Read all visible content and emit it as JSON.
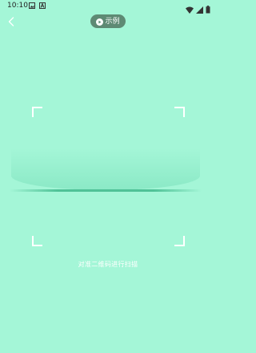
{
  "status_bar": {
    "time": "10:10",
    "icons": [
      "image-icon",
      "a-notification-icon",
      "wifi-icon",
      "signal-icon",
      "battery-icon"
    ]
  },
  "toolbar": {
    "back_icon": "chevron-left-icon",
    "example_label": "示例",
    "example_icon": "play-circle-icon"
  },
  "scanner": {
    "hint": "对准二维码进行扫描"
  },
  "colors": {
    "background": "#a4f6d7",
    "example_button": "#5e8a74",
    "scan_line": "#4fc297"
  }
}
